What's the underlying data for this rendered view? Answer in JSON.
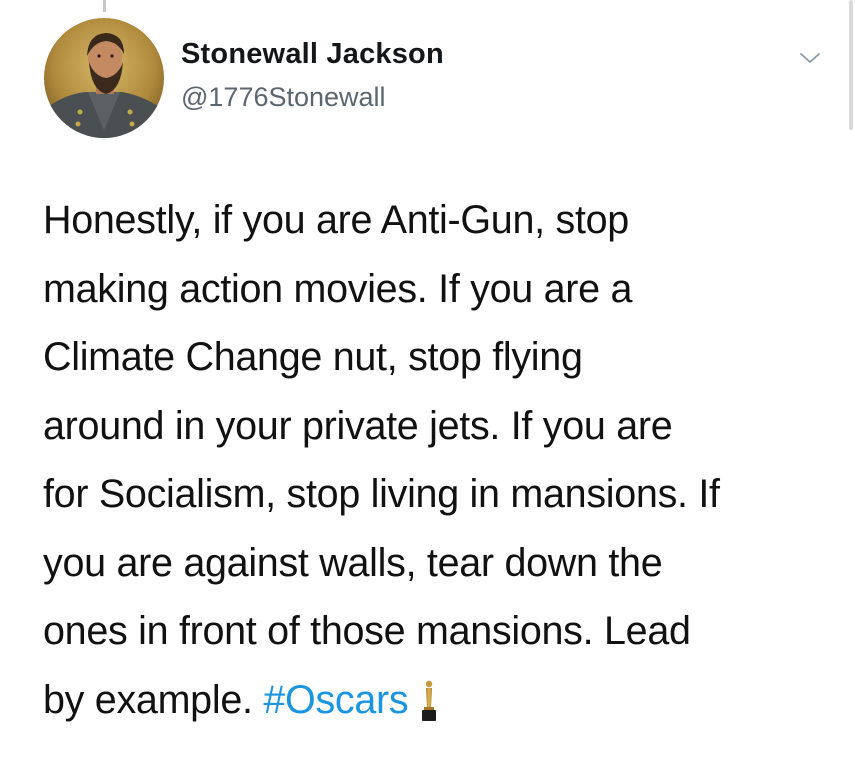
{
  "tweet": {
    "author": {
      "display_name": "Stonewall Jackson",
      "handle": "@1776Stonewall",
      "avatar_icon": "portrait-avatar"
    },
    "menu_icon": "chevron-down-icon",
    "text_lines": [
      "Honestly, if you are Anti-Gun, stop",
      "making action movies. If you are a",
      "Climate Change nut, stop flying",
      "around in your private jets. If you are",
      "for Socialism, stop living in mansions. If",
      "you are against walls, tear down the",
      "ones in front of those mansions. Lead",
      "by example."
    ],
    "hashtag": "#Oscars",
    "trailing_emoji_icon": "oscar-statuette-icon"
  },
  "colors": {
    "text": "#111111",
    "name": "#14171a",
    "handle": "#5b6670",
    "hashtag": "#1b95e0",
    "chevron": "#8899a6"
  }
}
